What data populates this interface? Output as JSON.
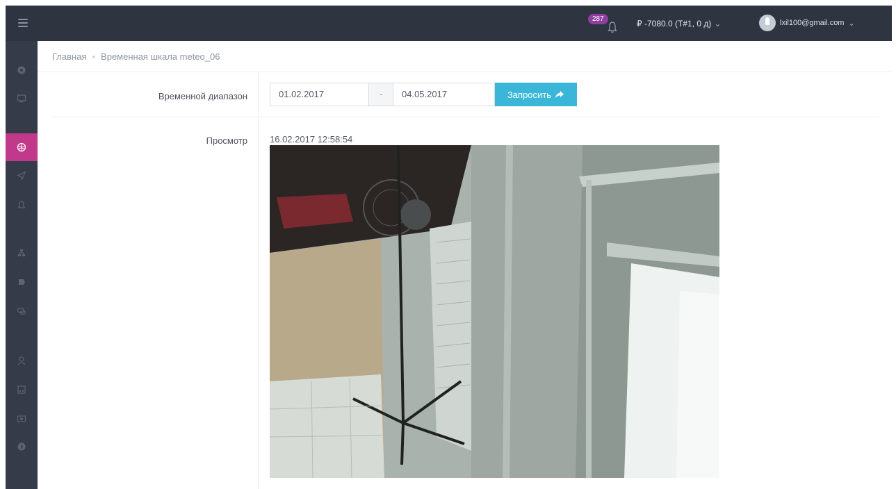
{
  "topbar": {
    "notifications_count": "287",
    "balance": "₽ -7080.0 (T#1, 0 д)",
    "user_email": "lxil100@gmail.com"
  },
  "sidebar": {
    "items": [
      "dashboard-icon",
      "monitor-icon",
      "meteo-icon",
      "send-icon",
      "bell-icon",
      "hierarchy-icon",
      "tag-icon",
      "chat-icon",
      "user-icon",
      "calendar-icon",
      "camera-icon",
      "info-icon"
    ],
    "active_item": "meteo-icon",
    "accent_color": "#c0398b"
  },
  "breadcrumb": {
    "home": "Главная",
    "current": "Временная шкала meteo_06"
  },
  "form": {
    "range_label": "Временной диапазон",
    "date_from": "01.02.2017",
    "range_separator": "-",
    "date_to": "04.05.2017",
    "query_button": "Запросить"
  },
  "preview": {
    "label": "Просмотр",
    "timestamp": "16.02.2017 12:58:54"
  },
  "colors": {
    "topbar": "#2e3440",
    "sidebar": "#353b48",
    "button": "#3ab7d8",
    "badge": "#8e3fa0"
  }
}
